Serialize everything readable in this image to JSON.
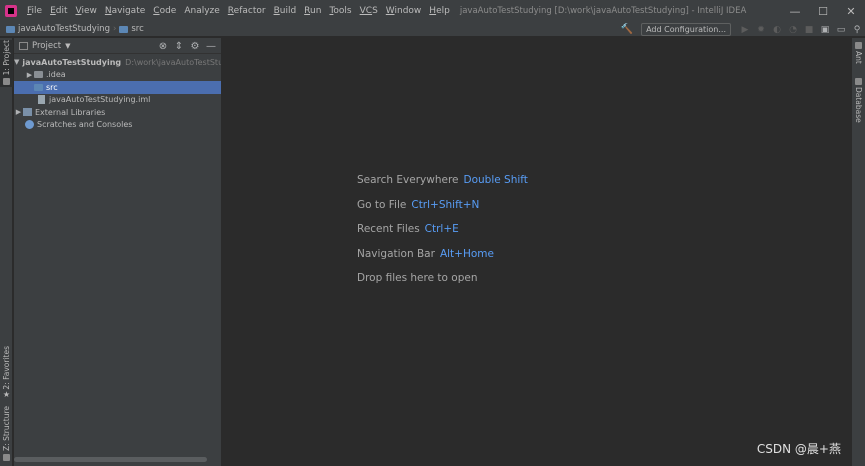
{
  "window": {
    "title": "javaAutoTestStudying [D:\\work\\javaAutoTestStudying] - IntelliJ IDEA",
    "controls": [
      "—",
      "☐",
      "✕"
    ]
  },
  "menu": [
    {
      "first": "F",
      "rest": "ile"
    },
    {
      "first": "E",
      "rest": "dit"
    },
    {
      "first": "V",
      "rest": "iew"
    },
    {
      "first": "N",
      "rest": "avigate"
    },
    {
      "first": "C",
      "rest": "ode"
    },
    {
      "first": "",
      "rest": "Analyze"
    },
    {
      "first": "R",
      "rest": "efactor"
    },
    {
      "first": "B",
      "rest": "uild"
    },
    {
      "first": "R",
      "rest": "un"
    },
    {
      "first": "T",
      "rest": "ools"
    },
    {
      "first": "VC",
      "rest": "S"
    },
    {
      "first": "W",
      "rest": "indow"
    },
    {
      "first": "H",
      "rest": "elp"
    }
  ],
  "navbar": {
    "project": "javaAutoTestStudying",
    "folder": "src",
    "add_config": "Add Configuration..."
  },
  "left_stripe": {
    "project_tab": "1: Project",
    "favorites_tab": "2: Favorites",
    "structure_tab": "Z: Structure"
  },
  "right_stripe": {
    "ant_tab": "Ant",
    "database_tab": "Database"
  },
  "project_panel": {
    "title": "Project",
    "tree": {
      "root_name": "javaAutoTestStudying",
      "root_path": "D:\\work\\javaAutoTestStudying",
      "idea": ".idea",
      "src": "src",
      "iml": "javaAutoTestStudying.iml",
      "ext_libs": "External Libraries",
      "scratches": "Scratches and Consoles"
    }
  },
  "editor": {
    "hints": [
      {
        "label": "Search Everywhere",
        "key": "Double Shift"
      },
      {
        "label": "Go to File",
        "key": "Ctrl+Shift+N"
      },
      {
        "label": "Recent Files",
        "key": "Ctrl+E"
      },
      {
        "label": "Navigation Bar",
        "key": "Alt+Home"
      },
      {
        "label": "Drop files here to open",
        "key": ""
      }
    ]
  },
  "watermark": "CSDN @晨+燕"
}
